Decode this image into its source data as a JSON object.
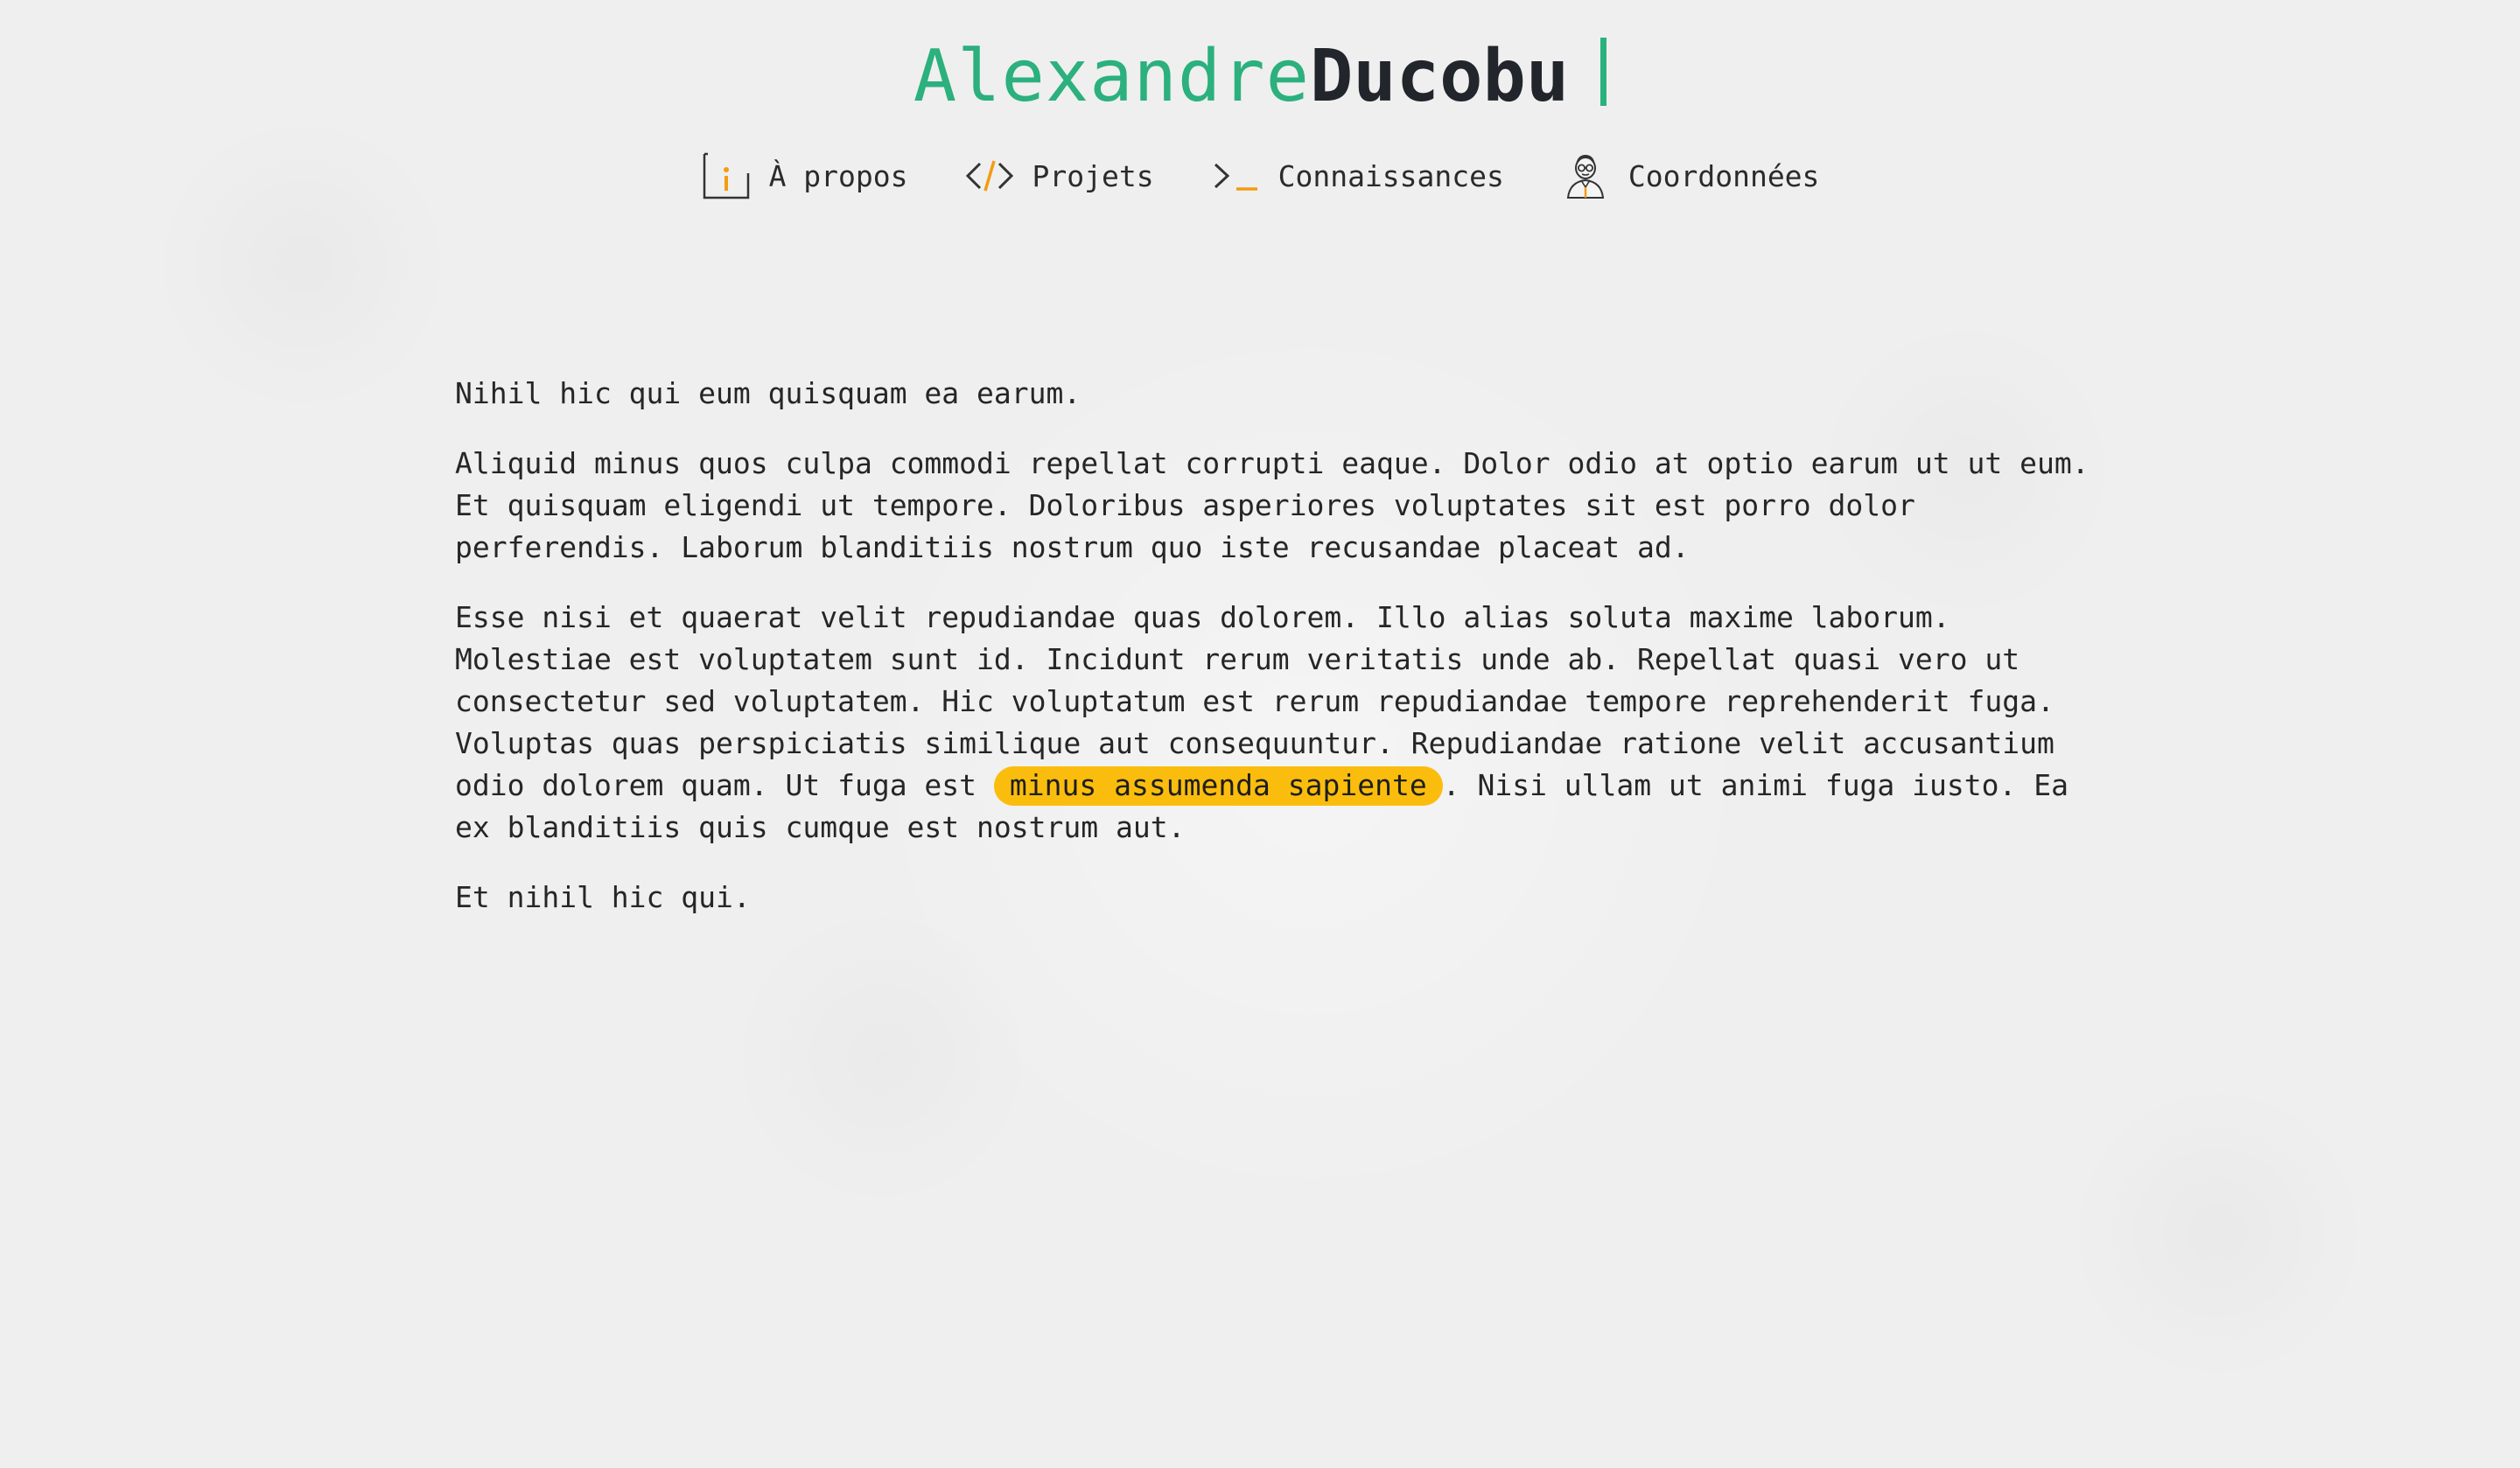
{
  "header": {
    "first_name": "Alexandre",
    "last_name": "Ducobu"
  },
  "nav": {
    "items": [
      {
        "label": "À propos",
        "icon": "info-icon"
      },
      {
        "label": "Projets",
        "icon": "code-icon"
      },
      {
        "label": "Connaissances",
        "icon": "terminal-icon"
      },
      {
        "label": "Coordonnées",
        "icon": "person-avatar-icon"
      }
    ]
  },
  "content": {
    "p1": "Nihil hic qui eum quisquam ea earum.",
    "p2": "Aliquid minus quos culpa commodi repellat corrupti eaque. Dolor odio at optio earum ut ut eum. Et quisquam eligendi ut tempore. Doloribus asperiores voluptates sit est porro dolor perferendis. Laborum blanditiis nostrum quo iste recusandae placeat ad.",
    "p3_before": "Esse nisi et quaerat velit repudiandae quas dolorem. Illo alias soluta maxime laborum. Molestiae est voluptatem sunt id. Incidunt rerum veritatis unde ab. Repellat quasi vero ut consectetur sed voluptatem. Hic voluptatum est rerum repudiandae tempore reprehenderit fuga. Voluptas quas perspiciatis similique aut consequuntur. Repudiandae ratione velit accusantium odio dolorem quam. Ut fuga est ",
    "p3_highlight": "minus assumenda sapiente",
    "p3_after": ". Nisi ullam ut animi fuga iusto. Ea ex blanditiis quis cumque est nostrum aut.",
    "p4": "Et nihil hic qui."
  },
  "colors": {
    "accent_green": "#2bb07e",
    "accent_orange": "#f39c12",
    "highlight": "#fbbd0d",
    "text_dark": "#22252b",
    "background": "#efefef"
  }
}
